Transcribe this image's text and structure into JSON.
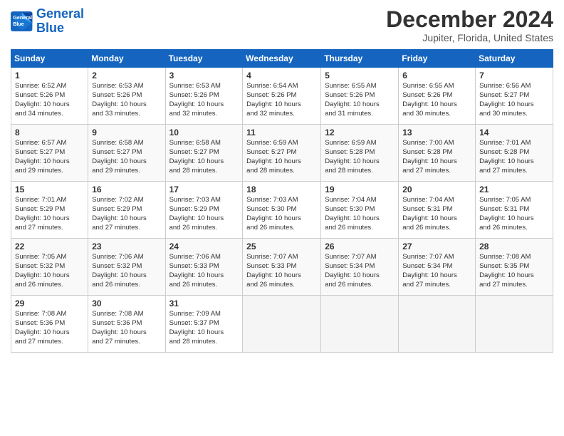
{
  "logo": {
    "line1": "General",
    "line2": "Blue"
  },
  "title": "December 2024",
  "location": "Jupiter, Florida, United States",
  "days_of_week": [
    "Sunday",
    "Monday",
    "Tuesday",
    "Wednesday",
    "Thursday",
    "Friday",
    "Saturday"
  ],
  "weeks": [
    [
      {
        "day": "1",
        "info": "Sunrise: 6:52 AM\nSunset: 5:26 PM\nDaylight: 10 hours\nand 34 minutes."
      },
      {
        "day": "2",
        "info": "Sunrise: 6:53 AM\nSunset: 5:26 PM\nDaylight: 10 hours\nand 33 minutes."
      },
      {
        "day": "3",
        "info": "Sunrise: 6:53 AM\nSunset: 5:26 PM\nDaylight: 10 hours\nand 32 minutes."
      },
      {
        "day": "4",
        "info": "Sunrise: 6:54 AM\nSunset: 5:26 PM\nDaylight: 10 hours\nand 32 minutes."
      },
      {
        "day": "5",
        "info": "Sunrise: 6:55 AM\nSunset: 5:26 PM\nDaylight: 10 hours\nand 31 minutes."
      },
      {
        "day": "6",
        "info": "Sunrise: 6:55 AM\nSunset: 5:26 PM\nDaylight: 10 hours\nand 30 minutes."
      },
      {
        "day": "7",
        "info": "Sunrise: 6:56 AM\nSunset: 5:27 PM\nDaylight: 10 hours\nand 30 minutes."
      }
    ],
    [
      {
        "day": "8",
        "info": "Sunrise: 6:57 AM\nSunset: 5:27 PM\nDaylight: 10 hours\nand 29 minutes."
      },
      {
        "day": "9",
        "info": "Sunrise: 6:58 AM\nSunset: 5:27 PM\nDaylight: 10 hours\nand 29 minutes."
      },
      {
        "day": "10",
        "info": "Sunrise: 6:58 AM\nSunset: 5:27 PM\nDaylight: 10 hours\nand 28 minutes."
      },
      {
        "day": "11",
        "info": "Sunrise: 6:59 AM\nSunset: 5:27 PM\nDaylight: 10 hours\nand 28 minutes."
      },
      {
        "day": "12",
        "info": "Sunrise: 6:59 AM\nSunset: 5:28 PM\nDaylight: 10 hours\nand 28 minutes."
      },
      {
        "day": "13",
        "info": "Sunrise: 7:00 AM\nSunset: 5:28 PM\nDaylight: 10 hours\nand 27 minutes."
      },
      {
        "day": "14",
        "info": "Sunrise: 7:01 AM\nSunset: 5:28 PM\nDaylight: 10 hours\nand 27 minutes."
      }
    ],
    [
      {
        "day": "15",
        "info": "Sunrise: 7:01 AM\nSunset: 5:29 PM\nDaylight: 10 hours\nand 27 minutes."
      },
      {
        "day": "16",
        "info": "Sunrise: 7:02 AM\nSunset: 5:29 PM\nDaylight: 10 hours\nand 27 minutes."
      },
      {
        "day": "17",
        "info": "Sunrise: 7:03 AM\nSunset: 5:29 PM\nDaylight: 10 hours\nand 26 minutes."
      },
      {
        "day": "18",
        "info": "Sunrise: 7:03 AM\nSunset: 5:30 PM\nDaylight: 10 hours\nand 26 minutes."
      },
      {
        "day": "19",
        "info": "Sunrise: 7:04 AM\nSunset: 5:30 PM\nDaylight: 10 hours\nand 26 minutes."
      },
      {
        "day": "20",
        "info": "Sunrise: 7:04 AM\nSunset: 5:31 PM\nDaylight: 10 hours\nand 26 minutes."
      },
      {
        "day": "21",
        "info": "Sunrise: 7:05 AM\nSunset: 5:31 PM\nDaylight: 10 hours\nand 26 minutes."
      }
    ],
    [
      {
        "day": "22",
        "info": "Sunrise: 7:05 AM\nSunset: 5:32 PM\nDaylight: 10 hours\nand 26 minutes."
      },
      {
        "day": "23",
        "info": "Sunrise: 7:06 AM\nSunset: 5:32 PM\nDaylight: 10 hours\nand 26 minutes."
      },
      {
        "day": "24",
        "info": "Sunrise: 7:06 AM\nSunset: 5:33 PM\nDaylight: 10 hours\nand 26 minutes."
      },
      {
        "day": "25",
        "info": "Sunrise: 7:07 AM\nSunset: 5:33 PM\nDaylight: 10 hours\nand 26 minutes."
      },
      {
        "day": "26",
        "info": "Sunrise: 7:07 AM\nSunset: 5:34 PM\nDaylight: 10 hours\nand 26 minutes."
      },
      {
        "day": "27",
        "info": "Sunrise: 7:07 AM\nSunset: 5:34 PM\nDaylight: 10 hours\nand 27 minutes."
      },
      {
        "day": "28",
        "info": "Sunrise: 7:08 AM\nSunset: 5:35 PM\nDaylight: 10 hours\nand 27 minutes."
      }
    ],
    [
      {
        "day": "29",
        "info": "Sunrise: 7:08 AM\nSunset: 5:36 PM\nDaylight: 10 hours\nand 27 minutes."
      },
      {
        "day": "30",
        "info": "Sunrise: 7:08 AM\nSunset: 5:36 PM\nDaylight: 10 hours\nand 27 minutes."
      },
      {
        "day": "31",
        "info": "Sunrise: 7:09 AM\nSunset: 5:37 PM\nDaylight: 10 hours\nand 28 minutes."
      },
      {
        "day": "",
        "info": ""
      },
      {
        "day": "",
        "info": ""
      },
      {
        "day": "",
        "info": ""
      },
      {
        "day": "",
        "info": ""
      }
    ]
  ]
}
